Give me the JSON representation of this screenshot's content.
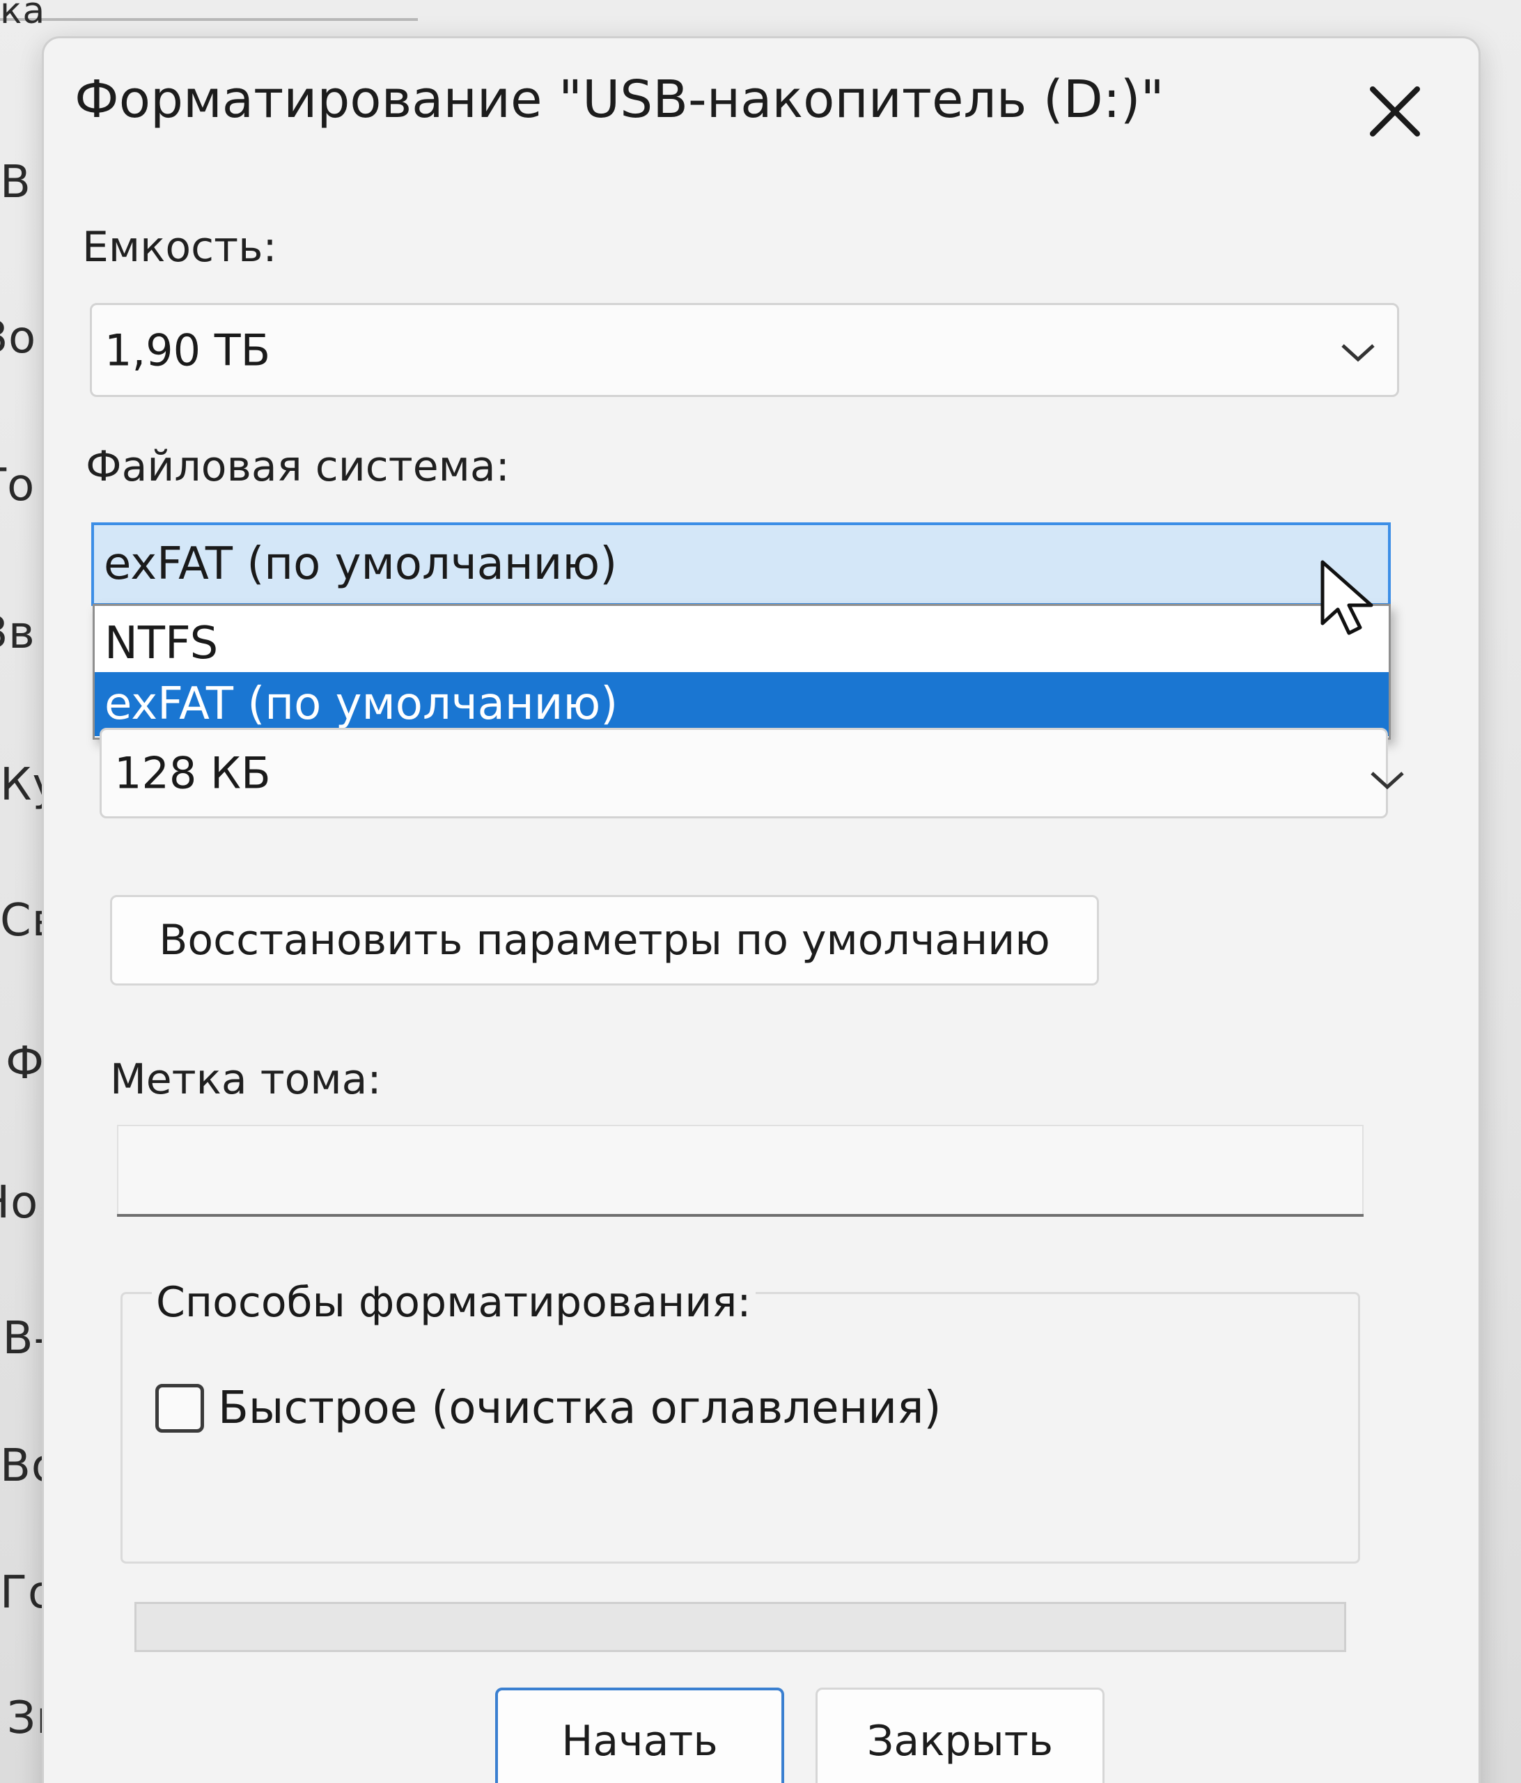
{
  "background": {
    "items": [
      "ка",
      "В",
      "Зо",
      "То",
      "Зв",
      "Ку",
      "Св",
      "Фи",
      "Нов",
      "SB-н",
      "Вор",
      "Гого",
      "Звез"
    ]
  },
  "dialog": {
    "title": "Форматирование \"USB-накопитель (D:)\"",
    "close_icon": "close-icon",
    "capacity": {
      "label": "Емкость:",
      "value": "1,90 ТБ"
    },
    "filesystem": {
      "label": "Файловая система:",
      "value": "exFAT (по умолчанию)",
      "options": [
        "NTFS",
        "exFAT (по умолчанию)"
      ],
      "selected_index": 1
    },
    "allocation": {
      "value": "128 КБ"
    },
    "restore_defaults_label": "Восстановить параметры по умолчанию",
    "volume_label": {
      "label": "Метка тома:",
      "value": ""
    },
    "format_options": {
      "title": "Способы форматирования:",
      "quick_format_label": "Быстрое (очистка оглавления)",
      "quick_format_checked": false
    },
    "progress": 0,
    "start_label": "Начать",
    "close_label": "Закрыть"
  },
  "colors": {
    "accent": "#1a76d2",
    "dialog_bg": "#f3f3f3",
    "open_combo_bg": "#d4e7f8",
    "primary_border": "#3a7fd0"
  }
}
